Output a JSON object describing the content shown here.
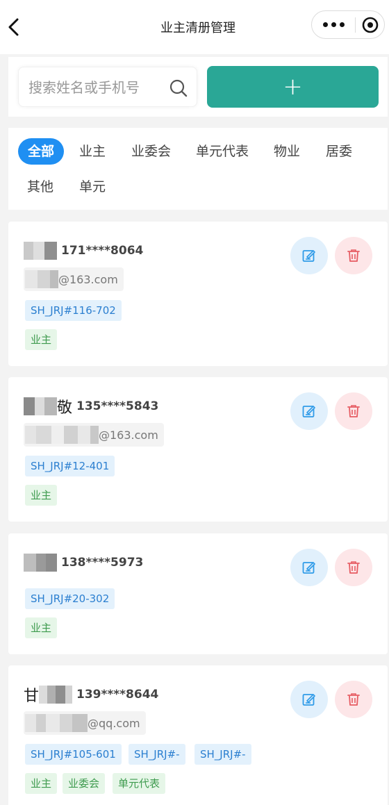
{
  "nav": {
    "title": "业主清册管理"
  },
  "search": {
    "placeholder": "搜索姓名或手机号",
    "value": "",
    "add_label": "+"
  },
  "tabs": [
    {
      "label": "全部",
      "active": true
    },
    {
      "label": "业主",
      "active": false
    },
    {
      "label": "业委会",
      "active": false
    },
    {
      "label": "单元代表",
      "active": false
    },
    {
      "label": "物业",
      "active": false
    },
    {
      "label": "居委",
      "active": false
    },
    {
      "label": "其他",
      "active": false
    },
    {
      "label": "单元",
      "active": false
    }
  ],
  "colors": {
    "accent": "#2aa796",
    "active_tab": "#1f8ff2",
    "edit_bg": "#e1f0fc",
    "edit_icon": "#2f9be8",
    "delete_bg": "#fde6e8",
    "delete_icon": "#e65b62",
    "unit_tag_bg": "#e3f1fc",
    "unit_tag_text": "#2b7fd0",
    "role_tag_bg": "#e6f6e8",
    "role_tag_text": "#3e9b4e"
  },
  "icons": {
    "back": "chevron-left-icon",
    "more": "more-dots-icon",
    "close": "target-close-icon",
    "search": "search-icon",
    "edit": "edit-icon",
    "delete": "trash-icon"
  },
  "cards": [
    {
      "name_visible": "",
      "phone": "171****8064",
      "email_suffix": "@163.com",
      "unit_tags": [
        "SH_JRJ#116-702"
      ],
      "role_tags": [
        "业主"
      ]
    },
    {
      "name_visible": "敬",
      "phone": "135****5843",
      "email_suffix": "@163.com",
      "unit_tags": [
        "SH_JRJ#12-401"
      ],
      "role_tags": [
        "业主"
      ]
    },
    {
      "name_visible": "",
      "phone": "138****5973",
      "email_suffix": "",
      "unit_tags": [
        "SH_JRJ#20-302"
      ],
      "role_tags": [
        "业主"
      ]
    },
    {
      "name_visible": "甘",
      "phone": "139****8644",
      "email_suffix": "@qq.com",
      "unit_tags": [
        "SH_JRJ#105-601",
        "SH_JRJ#-",
        "SH_JRJ#-"
      ],
      "role_tags": [
        "业主",
        "业委会",
        "单元代表"
      ]
    }
  ]
}
